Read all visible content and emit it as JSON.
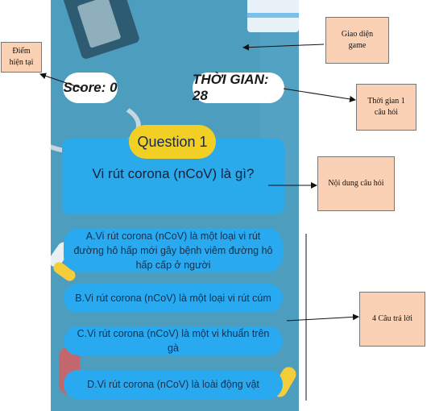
{
  "game": {
    "score_label": "Score: 0",
    "timer_label": "THỜI GIAN: 28",
    "question_badge": "Question 1",
    "question_text": "Vi rút corona (nCoV) là gì?",
    "answers": [
      {
        "text": "A.Vi rút corona (nCoV) là một loại vi rút đường hô hấp mới gây bệnh viêm đường hô hấp cấp ở người"
      },
      {
        "text": "B.Vi rút corona (nCoV) là một loại vi rút cúm"
      },
      {
        "text": "C.Vi rút corona (nCoV) là một vi khuẩn trên gà"
      },
      {
        "text": "D.Vi rút corona (nCoV) là loài động vật"
      }
    ],
    "colors": {
      "background": "#4d9dbe",
      "card": "#2aa9eb",
      "badge": "#f2cf24",
      "pill": "#ffffff"
    }
  },
  "annotations": {
    "current_score_line1": "Điểm",
    "current_score_line2": "hiện tại",
    "game_ui_line1": "Giao diện",
    "game_ui_line2": "game",
    "time_line1": "Thời gian 1",
    "time_line2": "câu hỏi",
    "question_content": "Nội dung câu hỏi",
    "answers_label": "4 Câu trả lời",
    "box_color": "#fbd1b5"
  }
}
